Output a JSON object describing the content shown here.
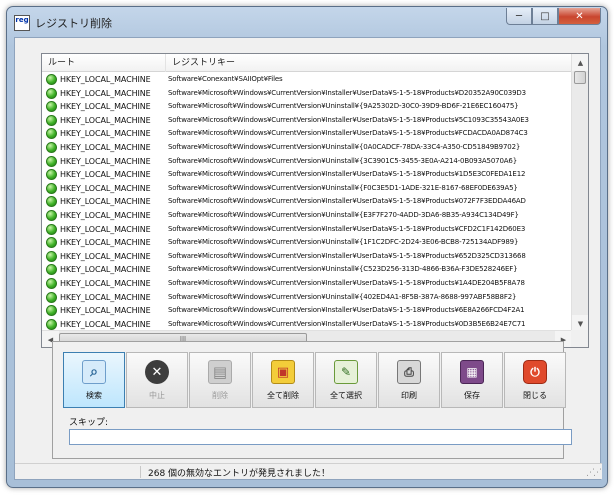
{
  "window": {
    "title": "レジストリ削除",
    "app_icon_text": "reg",
    "caption": {
      "minimize": "─",
      "maximize": "□",
      "close": "✕"
    }
  },
  "list": {
    "columns": [
      "ルート",
      "レジストリキー"
    ],
    "rows": [
      {
        "root": "HKEY_LOCAL_MACHINE",
        "key": "Software¥Conexant¥SAIIOpt¥Files"
      },
      {
        "root": "HKEY_LOCAL_MACHINE",
        "key": "Software¥Microsoft¥Windows¥CurrentVersion¥Installer¥UserData¥S-1-5-18¥Products¥D20352A90C039D3"
      },
      {
        "root": "HKEY_LOCAL_MACHINE",
        "key": "Software¥Microsoft¥Windows¥CurrentVersion¥Uninstall¥{9A25302D-30C0-39D9-BD6F-21E6EC160475}"
      },
      {
        "root": "HKEY_LOCAL_MACHINE",
        "key": "Software¥Microsoft¥Windows¥CurrentVersion¥Installer¥UserData¥S-1-5-18¥Products¥5C1093C35543A0E3"
      },
      {
        "root": "HKEY_LOCAL_MACHINE",
        "key": "Software¥Microsoft¥Windows¥CurrentVersion¥Installer¥UserData¥S-1-5-18¥Products¥FCDACDA0AD874C3"
      },
      {
        "root": "HKEY_LOCAL_MACHINE",
        "key": "Software¥Microsoft¥Windows¥CurrentVersion¥Uninstall¥{0A0CADCF-78DA-33C4-A350-CD51849B9702}"
      },
      {
        "root": "HKEY_LOCAL_MACHINE",
        "key": "Software¥Microsoft¥Windows¥CurrentVersion¥Uninstall¥{3C3901C5-3455-3E0A-A214-0B093A5070A6}"
      },
      {
        "root": "HKEY_LOCAL_MACHINE",
        "key": "Software¥Microsoft¥Windows¥CurrentVersion¥Installer¥UserData¥S-1-5-18¥Products¥1D5E3C0FEDA1E12"
      },
      {
        "root": "HKEY_LOCAL_MACHINE",
        "key": "Software¥Microsoft¥Windows¥CurrentVersion¥Uninstall¥{F0C3E5D1-1ADE-321E-8167-68EF0DE639A5}"
      },
      {
        "root": "HKEY_LOCAL_MACHINE",
        "key": "Software¥Microsoft¥Windows¥CurrentVersion¥Installer¥UserData¥S-1-5-18¥Products¥072F7F3EDDA46AD"
      },
      {
        "root": "HKEY_LOCAL_MACHINE",
        "key": "Software¥Microsoft¥Windows¥CurrentVersion¥Uninstall¥{E3F7F270-4ADD-3DA6-8B35-A934C134D49F}"
      },
      {
        "root": "HKEY_LOCAL_MACHINE",
        "key": "Software¥Microsoft¥Windows¥CurrentVersion¥Installer¥UserData¥S-1-5-18¥Products¥CFD2C1F142D60E3"
      },
      {
        "root": "HKEY_LOCAL_MACHINE",
        "key": "Software¥Microsoft¥Windows¥CurrentVersion¥Uninstall¥{1F1C2DFC-2D24-3E06-BCB8-725134ADF989}"
      },
      {
        "root": "HKEY_LOCAL_MACHINE",
        "key": "Software¥Microsoft¥Windows¥CurrentVersion¥Installer¥UserData¥S-1-5-18¥Products¥652D325CD313668"
      },
      {
        "root": "HKEY_LOCAL_MACHINE",
        "key": "Software¥Microsoft¥Windows¥CurrentVersion¥Uninstall¥{C523D256-313D-4866-B36A-F3DE528246EF}"
      },
      {
        "root": "HKEY_LOCAL_MACHINE",
        "key": "Software¥Microsoft¥Windows¥CurrentVersion¥Installer¥UserData¥S-1-5-18¥Products¥1A4DE204B5F8A78"
      },
      {
        "root": "HKEY_LOCAL_MACHINE",
        "key": "Software¥Microsoft¥Windows¥CurrentVersion¥Uninstall¥{402ED4A1-8F5B-387A-8688-997ABF58B8F2}"
      },
      {
        "root": "HKEY_LOCAL_MACHINE",
        "key": "Software¥Microsoft¥Windows¥CurrentVersion¥Installer¥UserData¥S-1-5-18¥Products¥6E8A266FCD4F2A1"
      },
      {
        "root": "HKEY_LOCAL_MACHINE",
        "key": "Software¥Microsoft¥Windows¥CurrentVersion¥Installer¥UserData¥S-1-5-18¥Products¥0D3B5E6B24E7C71"
      }
    ],
    "row_icon": "green-ok-icon",
    "h_thumb_grip": "III"
  },
  "toolbar": {
    "buttons": [
      {
        "label": "検索",
        "icon": "search-icon",
        "glyph": "⌕",
        "state": "active"
      },
      {
        "label": "中止",
        "icon": "stop-icon",
        "glyph": "✕",
        "state": "disabled"
      },
      {
        "label": "削除",
        "icon": "delete-icon",
        "glyph": "▤",
        "state": "disabled"
      },
      {
        "label": "全て削除",
        "icon": "delete-all-icon",
        "glyph": "▣",
        "state": "normal"
      },
      {
        "label": "全て選択",
        "icon": "select-all-icon",
        "glyph": "✎",
        "state": "normal"
      },
      {
        "label": "印刷",
        "icon": "print-icon",
        "glyph": "⎙",
        "state": "normal"
      },
      {
        "label": "保存",
        "icon": "save-icon",
        "glyph": "▦",
        "state": "normal"
      },
      {
        "label": "閉じる",
        "icon": "close-app-icon",
        "glyph": "⏻",
        "state": "normal"
      }
    ]
  },
  "skip": {
    "label": "スキップ:",
    "value": ""
  },
  "status": {
    "message": "268 個の無効なエントリが発見されました！"
  }
}
